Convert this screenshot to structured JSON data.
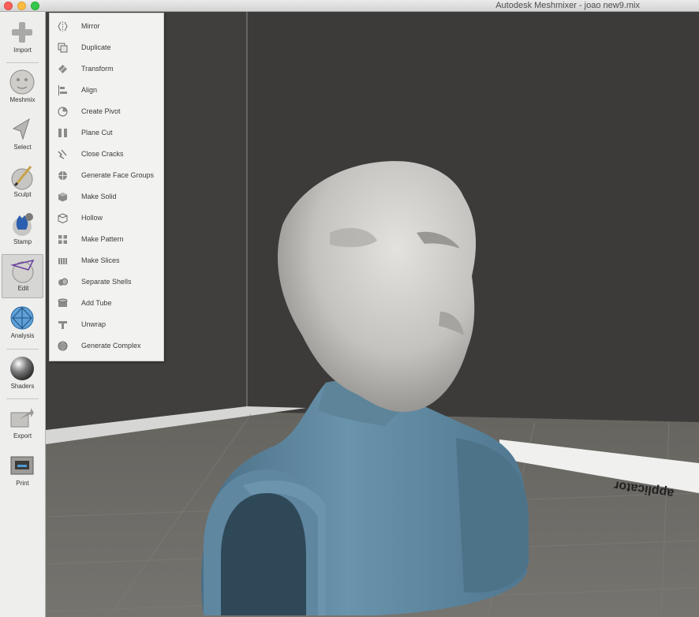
{
  "window": {
    "title": "Autodesk Meshmixer - joao new9.mix"
  },
  "sidebar": {
    "tools": [
      {
        "label": "Import",
        "icon": "plus-icon"
      },
      {
        "label": "Meshmix",
        "icon": "face-sphere-icon"
      },
      {
        "label": "Select",
        "icon": "arrow-cursor-icon"
      },
      {
        "label": "Sculpt",
        "icon": "brush-icon"
      },
      {
        "label": "Stamp",
        "icon": "fleur-stamp-icon"
      },
      {
        "label": "Edit",
        "icon": "edit-mesh-icon",
        "active": true
      },
      {
        "label": "Analysis",
        "icon": "analysis-mesh-icon"
      },
      {
        "label": "Shaders",
        "icon": "chrome-sphere-icon"
      },
      {
        "label": "Export",
        "icon": "export-icon"
      },
      {
        "label": "Print",
        "icon": "printer-icon"
      }
    ]
  },
  "edit_menu": {
    "items": [
      {
        "label": "Mirror",
        "icon": "mirror-icon"
      },
      {
        "label": "Duplicate",
        "icon": "duplicate-icon"
      },
      {
        "label": "Transform",
        "icon": "transform-icon"
      },
      {
        "label": "Align",
        "icon": "align-icon"
      },
      {
        "label": "Create Pivot",
        "icon": "pivot-icon"
      },
      {
        "label": "Plane Cut",
        "icon": "plane-cut-icon"
      },
      {
        "label": "Close Cracks",
        "icon": "close-cracks-icon"
      },
      {
        "label": "Generate Face Groups",
        "icon": "face-groups-icon"
      },
      {
        "label": "Make Solid",
        "icon": "make-solid-icon"
      },
      {
        "label": "Hollow",
        "icon": "hollow-icon"
      },
      {
        "label": "Make Pattern",
        "icon": "pattern-icon"
      },
      {
        "label": "Make Slices",
        "icon": "slices-icon"
      },
      {
        "label": "Separate Shells",
        "icon": "separate-shells-icon"
      },
      {
        "label": "Add Tube",
        "icon": "tube-icon"
      },
      {
        "label": "Unwrap",
        "icon": "unwrap-icon"
      },
      {
        "label": "Generate Complex",
        "icon": "complex-icon"
      }
    ]
  },
  "viewport": {
    "floor_text": "applicator",
    "colors": {
      "wall": "#3c3b39",
      "floor": "#6e6c68",
      "bust_head": "#c8c6c3",
      "bust_body": "#5f87a0"
    }
  }
}
